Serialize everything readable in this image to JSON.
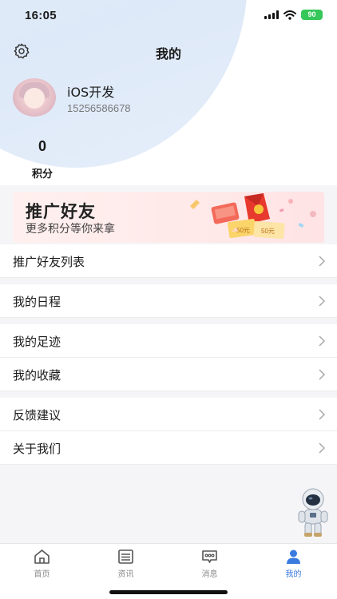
{
  "status_bar": {
    "time": "16:05",
    "battery": "90"
  },
  "nav": {
    "title": "我的",
    "settings_icon": "gear-icon"
  },
  "profile": {
    "name": "iOS开发",
    "phone": "15256586678"
  },
  "points": {
    "value": "0",
    "label": "积分"
  },
  "banner": {
    "title": "推广好友",
    "subtitle": "更多积分等你来拿",
    "coupon_text": "50元"
  },
  "menu": {
    "promote_list": "推广好友列表",
    "schedule": "我的日程",
    "footprint": "我的足迹",
    "favorites": "我的收藏",
    "feedback": "反馈建议",
    "about": "关于我们"
  },
  "tabbar": {
    "items": [
      {
        "label": "首页",
        "icon": "home-icon"
      },
      {
        "label": "资讯",
        "icon": "news-icon"
      },
      {
        "label": "消息",
        "icon": "message-icon"
      },
      {
        "label": "我的",
        "icon": "profile-icon"
      }
    ],
    "active_index": 3,
    "active_color": "#3b7be0",
    "inactive_color": "#888888"
  }
}
